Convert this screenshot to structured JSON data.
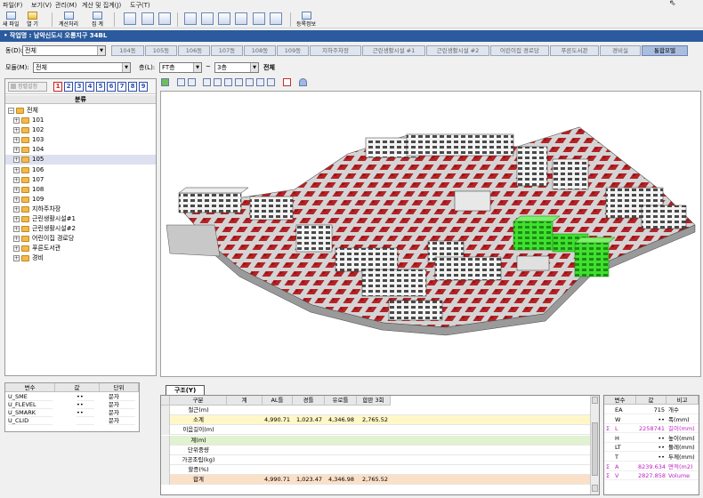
{
  "menu": [
    "파일(F)",
    "보기(V)",
    "관리(M)",
    "계산 및 집계(J)",
    "도구(T)"
  ],
  "toolbar": {
    "new_file": "새 파일",
    "open": "열 기",
    "calc": "계산처리",
    "aggregate": "집 계",
    "register": "등록정보"
  },
  "project": {
    "title": "• 작업명 : 남악신도시 오룡지구 34BL"
  },
  "dong": {
    "label": "동(D):",
    "value": "전체",
    "tabs": [
      "104동",
      "105동",
      "106동",
      "107동",
      "108동",
      "109동",
      "지하주차장",
      "근린생활시설 #1",
      "근린생활시설 #2",
      "어린이집 경로당",
      "푸른도서관",
      "경비실",
      "통합모델"
    ],
    "active_tab": "통합모델"
  },
  "module": {
    "label": "모듈(M):",
    "value": "전체",
    "floor_label": "층(L):",
    "floor_from": "FT층",
    "tilde": "~",
    "floor_to": "3층",
    "floor_all": "전체"
  },
  "tree": {
    "search_btn": "정렬설정",
    "num_buttons": [
      "1",
      "2",
      "3",
      "4",
      "5",
      "6",
      "7",
      "8",
      "9"
    ],
    "column": "분류",
    "root": "전체",
    "items": [
      "101",
      "102",
      "103",
      "104",
      "105",
      "106",
      "107",
      "108",
      "109",
      "지하주차장",
      "근린생활시설#1",
      "근린생활시설#2",
      "어린이집 경로당",
      "푸른도서관",
      "경비"
    ],
    "selected": "105"
  },
  "left_props": {
    "headers": [
      "변수",
      "값",
      "단위"
    ],
    "rows": [
      [
        "U_SME",
        "••",
        "문자"
      ],
      [
        "U_FLEVEL",
        "••",
        "문자"
      ],
      [
        "U_SMARK",
        "••",
        "문자"
      ],
      [
        "U_CLID",
        "",
        "문자"
      ]
    ]
  },
  "bottom": {
    "tab": "구조(Y)",
    "headers": [
      "구분",
      "계",
      "AL틀",
      "경틀",
      "유로틀",
      "합판 3회"
    ],
    "rows": [
      {
        "label": "철근(m)",
        "vals": [
          "",
          "",
          "",
          "",
          ""
        ]
      },
      {
        "label": "소계",
        "vals": [
          "",
          "4,990.71",
          "1,023.47",
          "4,346.98",
          "2,765.52"
        ]
      },
      {
        "label": "이음길이(m)",
        "vals": [
          "",
          "",
          "",
          "",
          ""
        ]
      },
      {
        "label": "계(m)",
        "vals": [
          "",
          "",
          "",
          "",
          ""
        ]
      },
      {
        "label": "단위중량",
        "vals": [
          "",
          "",
          "",
          "",
          ""
        ]
      },
      {
        "label": "가공조립(kg)",
        "vals": [
          "",
          "",
          "",
          "",
          ""
        ]
      },
      {
        "label": "할증(%)",
        "vals": [
          "",
          "",
          "",
          "",
          ""
        ]
      },
      {
        "label": "합계",
        "vals": [
          "",
          "4,990.71",
          "1,023.47",
          "4,346.98",
          "2,765.52"
        ]
      }
    ]
  },
  "right_props": {
    "headers": [
      "변수",
      "값",
      "비고"
    ],
    "rows": [
      {
        "var": "EA",
        "val": "715",
        "note": "개수",
        "sigma": false
      },
      {
        "var": "W",
        "val": "••",
        "note": "폭(mm)",
        "sigma": false
      },
      {
        "var": "L",
        "val": "2258741",
        "note": "길이(mm)",
        "sigma": true
      },
      {
        "var": "H",
        "val": "••",
        "note": "높이(mm)",
        "sigma": false
      },
      {
        "var": "LT",
        "val": "••",
        "note": "둘레(mm)",
        "sigma": false
      },
      {
        "var": "T",
        "val": "••",
        "note": "두께(mm)",
        "sigma": false
      },
      {
        "var": "A",
        "val": "8239.634",
        "note": "면적(m2)",
        "sigma": true
      },
      {
        "var": "V",
        "val": "2827.858",
        "note": "Volume",
        "sigma": true
      }
    ]
  },
  "colors": {
    "project_bar": "#2b5a9e",
    "selected_building": "#33dd22",
    "parking_tile": "#c0262c",
    "subtotal_row": "#fff7c8",
    "total_row": "#fbe0c8",
    "green_row": "#e0f2cf"
  }
}
